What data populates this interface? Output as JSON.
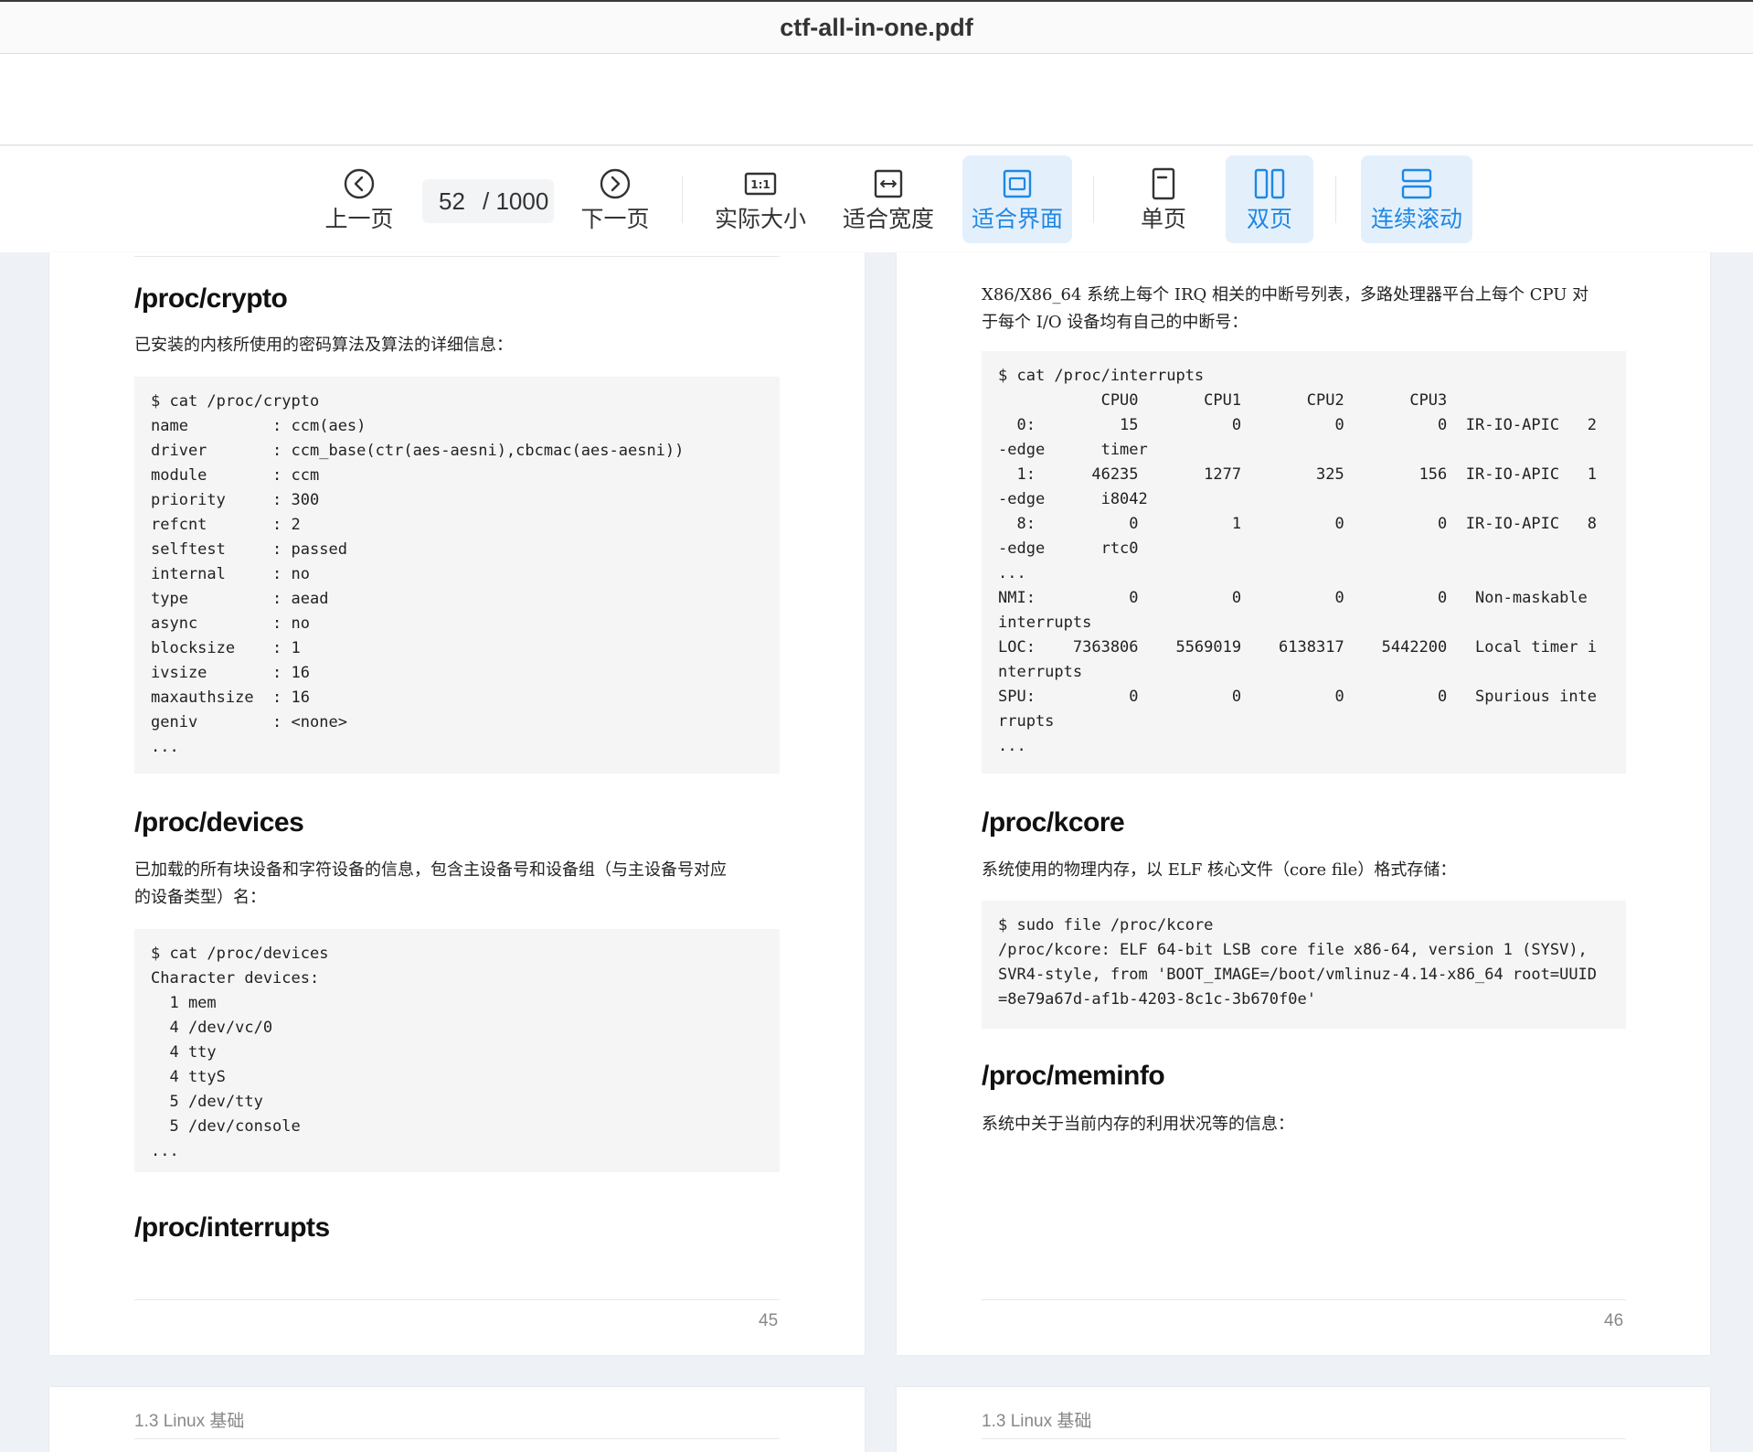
{
  "window": {
    "title": "ctf-all-in-one.pdf"
  },
  "toolbar": {
    "prev_label": "上一页",
    "next_label": "下一页",
    "current_page": "52",
    "total_pages": "/ 1000",
    "actual_size_label": "实际大小",
    "fit_width_label": "适合宽度",
    "fit_page_label": "适合界面",
    "single_label": "单页",
    "double_label": "双页",
    "continuous_label": "连续滚动",
    "accent_color": "#1f87e5",
    "active_bg": "#e3f0fc"
  },
  "page_left": {
    "sec1_title": "/proc/crypto",
    "sec1_desc": "已安装的内核所使用的密码算法及算法的详细信息：",
    "sec1_code": "$ cat /proc/crypto\nname         : ccm(aes)\ndriver       : ccm_base(ctr(aes-aesni),cbcmac(aes-aesni))\nmodule       : ccm\npriority     : 300\nrefcnt       : 2\nselftest     : passed\ninternal     : no\ntype         : aead\nasync        : no\nblocksize    : 1\nivsize       : 16\nmaxauthsize  : 16\ngeniv        : <none>\n...",
    "sec2_title": "/proc/devices",
    "sec2_desc_line1": "已加载的所有块设备和字符设备的信息，包含主设备号和设备组（与主设备号对应",
    "sec2_desc_line2": "的设备类型）名：",
    "sec2_code": "$ cat /proc/devices\nCharacter devices:\n  1 mem\n  4 /dev/vc/0\n  4 tty\n  4 ttyS\n  5 /dev/tty\n  5 /dev/console\n...",
    "sec3_title": "/proc/interrupts",
    "page_number": "45"
  },
  "page_right": {
    "intro_line1": "X86/X86_64 系统上每个 IRQ 相关的中断号列表，多路处理器平台上每个 CPU 对",
    "intro_line2": "于每个 I/O 设备均有自己的中断号：",
    "interrupts_code": "$ cat /proc/interrupts\n           CPU0       CPU1       CPU2       CPU3\n  0:         15          0          0          0  IR-IO-APIC   2\n-edge      timer\n  1:      46235       1277        325        156  IR-IO-APIC   1\n-edge      i8042\n  8:          0          1          0          0  IR-IO-APIC   8\n-edge      rtc0\n...\nNMI:          0          0          0          0   Non-maskable\ninterrupts\nLOC:    7363806    5569019    6138317    5442200   Local timer i\nnterrupts\nSPU:          0          0          0          0   Spurious inte\nrrupts\n...",
    "sec_kcore_title": "/proc/kcore",
    "sec_kcore_desc": "系统使用的物理内存，以 ELF 核心文件（core file）格式存储：",
    "kcore_code": "$ sudo file /proc/kcore\n/proc/kcore: ELF 64-bit LSB core file x86-64, version 1 (SYSV),\nSVR4-style, from 'BOOT_IMAGE=/boot/vmlinuz-4.14-x86_64 root=UUID\n=8e79a67d-af1b-4203-8c1c-3b670f0e'",
    "sec_meminfo_title": "/proc/meminfo",
    "sec_meminfo_desc": "系统中关于当前内存的利用状况等的信息：",
    "page_number": "46"
  },
  "page_next_left": {
    "header": "1.3 Linux 基础"
  },
  "page_next_right": {
    "header": "1.3 Linux 基础"
  }
}
